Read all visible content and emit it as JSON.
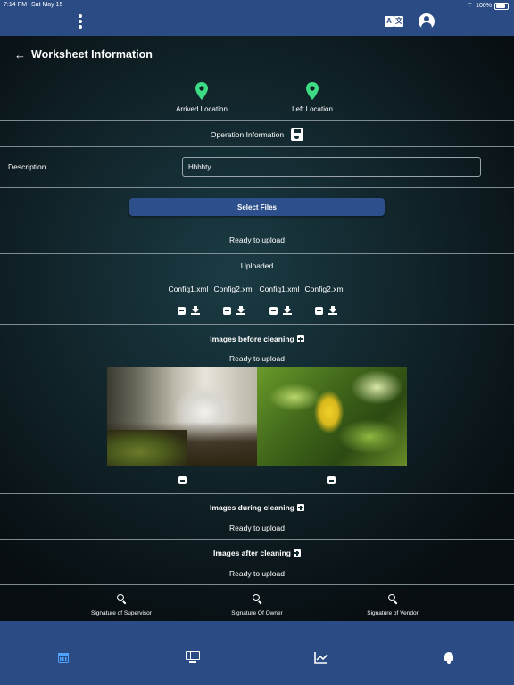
{
  "status_bar": {
    "time": "7:14 PM",
    "date": "Sat May 15",
    "battery": "100%"
  },
  "header": {
    "menu_icon": "kebab-menu-icon",
    "translate_icon": "translate-icon",
    "account_icon": "account-circle-icon"
  },
  "page": {
    "title": "Worksheet Information",
    "back_icon": "arrow-left-icon"
  },
  "locations": {
    "arrived_label": "Arrived Location",
    "left_label": "Left Location",
    "pin_color": "#3ddc84"
  },
  "operation": {
    "label": "Operation Information",
    "save_icon": "save-icon"
  },
  "description": {
    "label": "Description",
    "value": "Hhhhty"
  },
  "upload": {
    "button_label": "Select Files",
    "status": "Ready to upload",
    "button_color": "#2d4f8c"
  },
  "uploaded": {
    "heading": "Uploaded",
    "files": [
      "Config1.xml",
      "Config2.xml",
      "Config1.xml",
      "Config2.xml"
    ]
  },
  "images_before": {
    "heading": "Images before cleaning",
    "status": "Ready to upload",
    "photos": [
      "waterfall",
      "leaves"
    ]
  },
  "images_during": {
    "heading": "Images during cleaning",
    "status": "Ready to upload"
  },
  "images_after": {
    "heading": "Images after cleaning",
    "status": "Ready to upload"
  },
  "signatures": {
    "supervisor": "Signature of Supervisor",
    "owner": "Signature Of Owner",
    "vendor": "Signature of Vendor"
  },
  "bottom_nav": {
    "items": [
      {
        "icon": "calendar-icon",
        "active": true
      },
      {
        "icon": "dashboard-icon",
        "active": false
      },
      {
        "icon": "chart-line-icon",
        "active": false
      },
      {
        "icon": "bell-icon",
        "active": false
      }
    ],
    "active_color": "#4fa3ff",
    "bar_color": "#2a4b83"
  }
}
